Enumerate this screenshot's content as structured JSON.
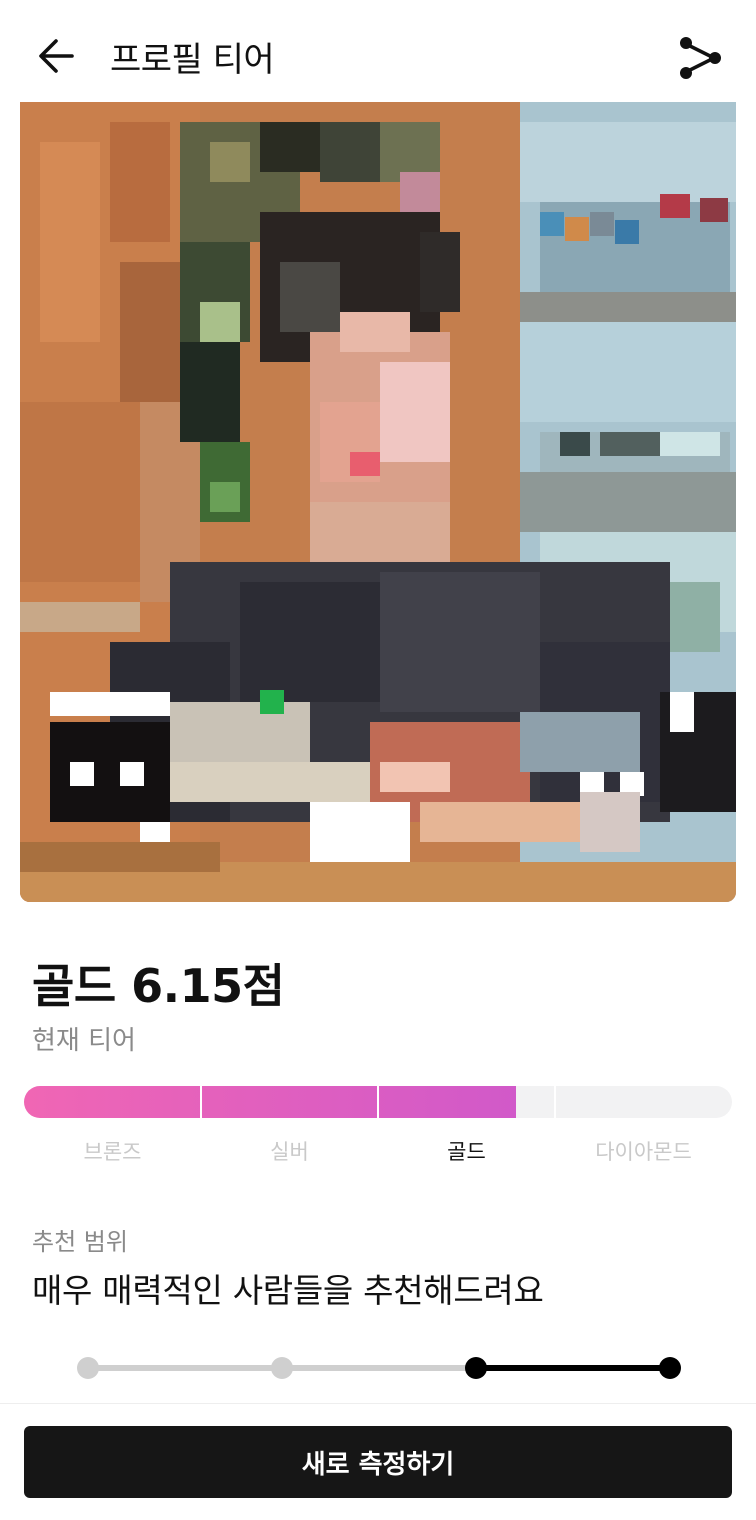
{
  "header": {
    "title": "프로필 티어",
    "back_icon": "arrow-left-icon",
    "share_icon": "share-icon"
  },
  "profile": {
    "photo": "pixelated-profile-photo",
    "score_text": "골드 6.15점",
    "current_tier_caption": "현재 티어"
  },
  "tier_bar": {
    "fill_fraction": 0.695,
    "fill_gradient": [
      "#f066b4",
      "#d159c9"
    ],
    "labels": [
      "브론즈",
      "실버",
      "골드",
      "다이아몬드"
    ],
    "active_index": 2
  },
  "recommendation": {
    "label": "추천 범위",
    "text": "매우 매력적인 사람들을 추천해드려요",
    "range_steps": 4,
    "selected_from": 2,
    "selected_to": 3
  },
  "cta": {
    "label": "새로 측정하기"
  }
}
